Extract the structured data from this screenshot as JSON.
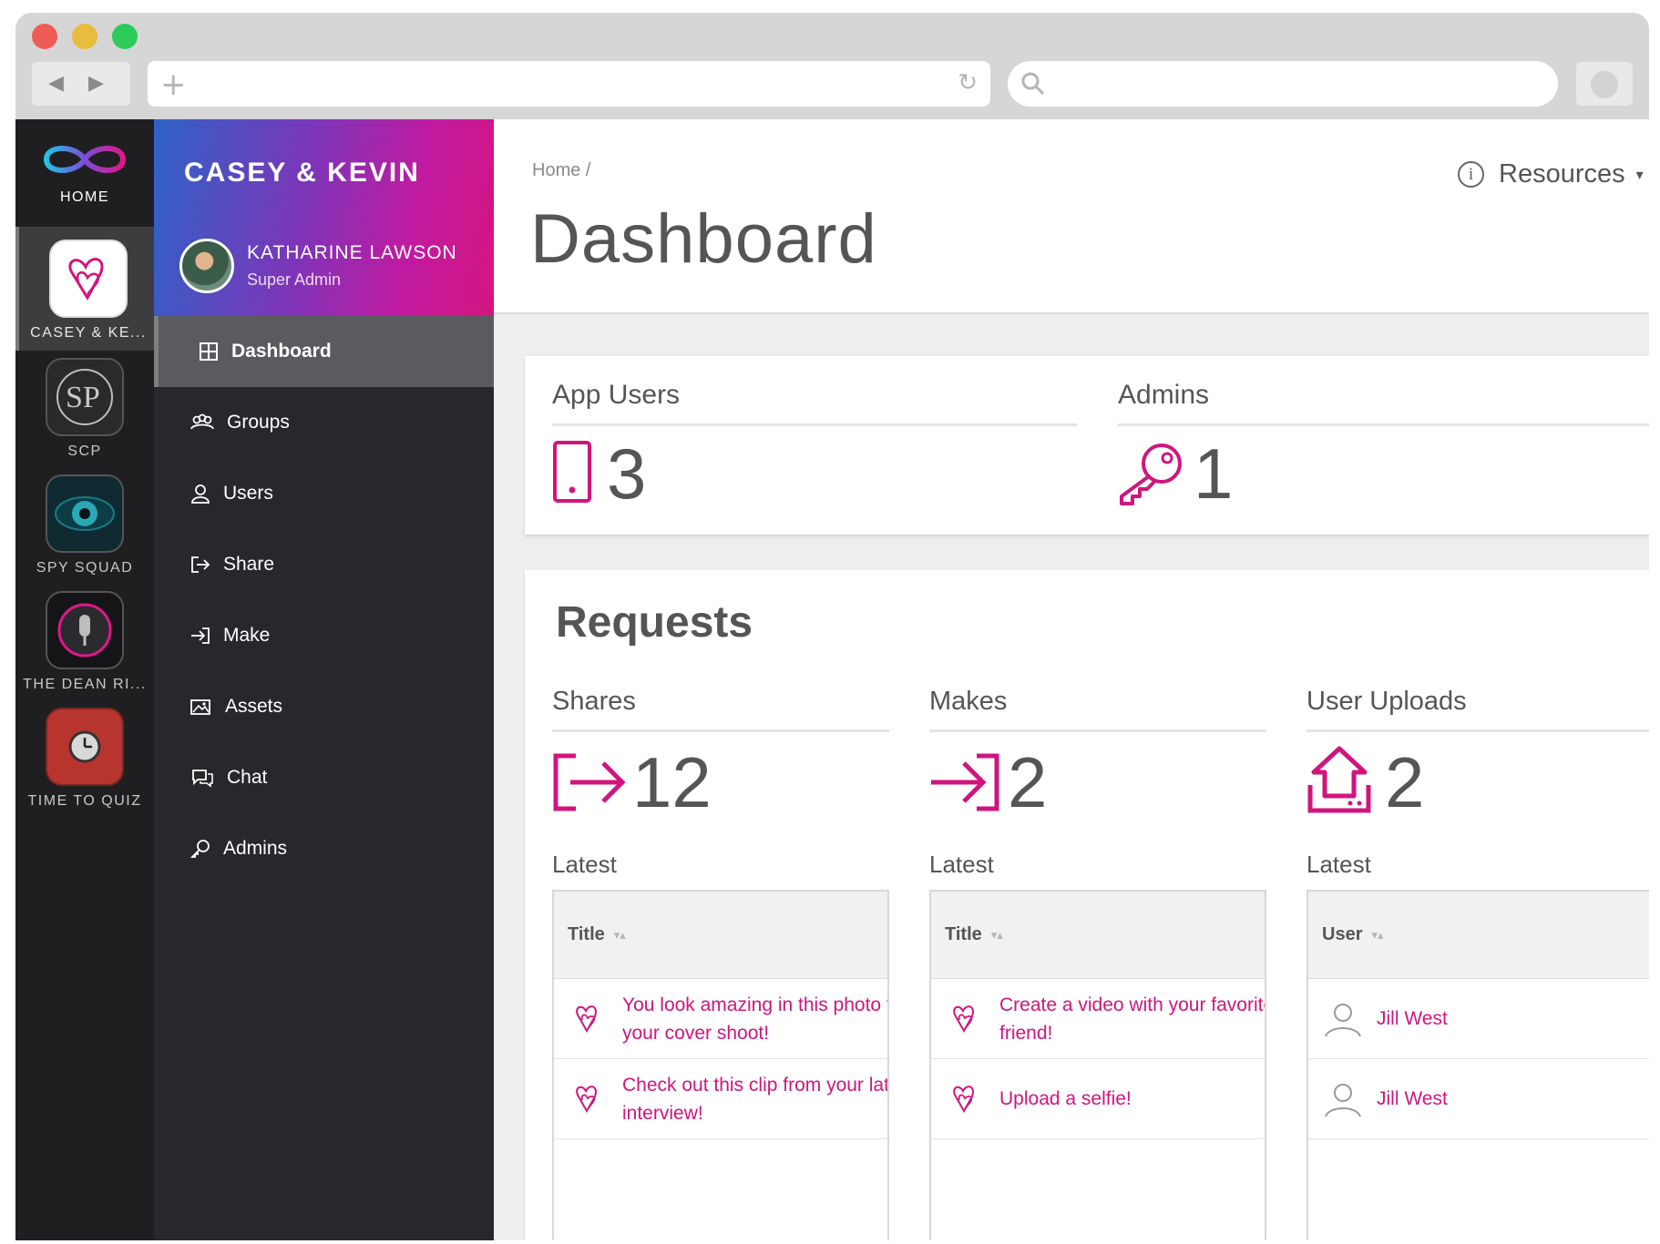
{
  "browser": {
    "address_value": "",
    "nav_back": "◀",
    "nav_forward": "▶",
    "new_tab": "+",
    "reload": "↻"
  },
  "rail": {
    "home_label": "HOME",
    "apps": [
      {
        "label": "CASEY & KE...",
        "active": true
      },
      {
        "label": "SCP",
        "active": false
      },
      {
        "label": "SPY SQUAD",
        "active": false
      },
      {
        "label": "THE DEAN RI...",
        "active": false
      },
      {
        "label": "TIME TO QUIZ",
        "active": false
      }
    ]
  },
  "sidebar": {
    "app_name": "CASEY & KEVIN",
    "user_name": "KATHARINE LAWSON",
    "user_role": "Super Admin",
    "menu": [
      {
        "label": "Dashboard",
        "icon": "grid-icon",
        "active": true
      },
      {
        "label": "Groups",
        "icon": "groups-icon",
        "active": false
      },
      {
        "label": "Users",
        "icon": "user-icon",
        "active": false
      },
      {
        "label": "Share",
        "icon": "share-icon",
        "active": false
      },
      {
        "label": "Make",
        "icon": "make-icon",
        "active": false
      },
      {
        "label": "Assets",
        "icon": "image-icon",
        "active": false
      },
      {
        "label": "Chat",
        "icon": "chat-icon",
        "active": false
      },
      {
        "label": "Admins",
        "icon": "key-icon",
        "active": false
      }
    ]
  },
  "header": {
    "breadcrumb": "Home /",
    "title": "Dashboard",
    "resources_label": "Resources",
    "resources_caret": "▾",
    "info_glyph": "i"
  },
  "stats": {
    "app_users": {
      "label": "App Users",
      "value": "3"
    },
    "admins": {
      "label": "Admins",
      "value": "1"
    }
  },
  "requests": {
    "title": "Requests",
    "columns": [
      {
        "label": "Shares",
        "value": "12",
        "latest_label": "Latest",
        "table_header": "Title",
        "rows": [
          {
            "line1": "You look amazing in this photo fror",
            "line2": "your cover shoot!"
          },
          {
            "line1": "Check out this clip from your latest",
            "line2": "interview!"
          }
        ]
      },
      {
        "label": "Makes",
        "value": "2",
        "latest_label": "Latest",
        "table_header": "Title",
        "rows": [
          {
            "line1": "Create a video with your favorite fu",
            "line2": "friend!"
          },
          {
            "line1": "Upload a selfie!",
            "line2": ""
          }
        ]
      },
      {
        "label": "User Uploads",
        "value": "2",
        "latest_label": "Latest",
        "table_header": "User",
        "rows": [
          {
            "line1": "Jill West"
          },
          {
            "line1": "Jill West"
          }
        ]
      }
    ],
    "sort_glyph": "▾▴"
  },
  "colors": {
    "accent": "#d0157f",
    "sidebar_bg": "#27282c",
    "rail_bg": "#1f1f21"
  }
}
